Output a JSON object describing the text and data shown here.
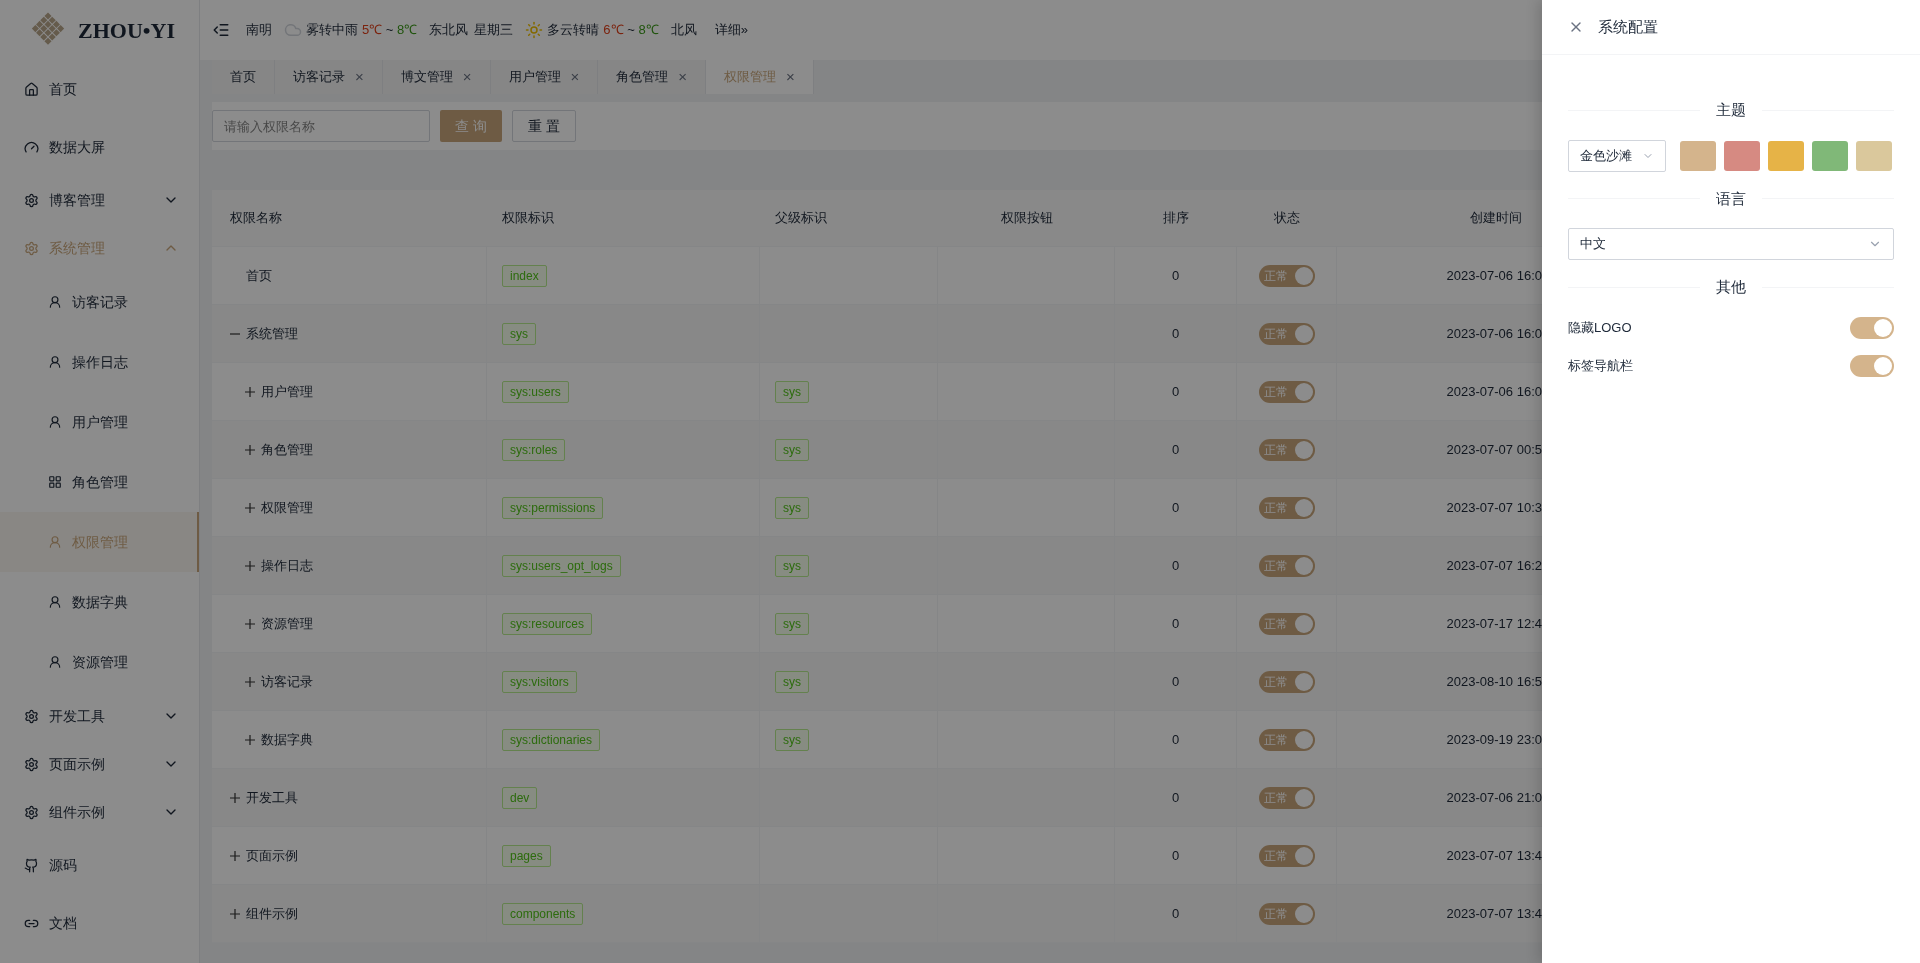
{
  "header": {
    "logo": "ZHOU•YI",
    "weather": {
      "city": "南明",
      "days": [
        {
          "desc": "雾转中雨",
          "low": "5℃",
          "sep": "~",
          "high": "8℃",
          "wind": "东北风",
          "weekday": "星期三"
        },
        {
          "desc": "多云转晴",
          "low": "6℃",
          "sep": "~",
          "high": "8℃",
          "wind": "北风"
        }
      ],
      "more": "详细»"
    }
  },
  "sidebar": {
    "items": [
      {
        "label": "首页",
        "selected": false
      },
      {
        "label": "数据大屏",
        "selected": false
      },
      {
        "label": "博客管理",
        "selected": false,
        "expanded": false
      },
      {
        "label": "系统管理",
        "selected": true,
        "expanded": true,
        "children": [
          {
            "label": "访客记录",
            "selected": false
          },
          {
            "label": "操作日志",
            "selected": false
          },
          {
            "label": "用户管理",
            "selected": false
          },
          {
            "label": "角色管理",
            "selected": false
          },
          {
            "label": "权限管理",
            "selected": true
          },
          {
            "label": "数据字典",
            "selected": false
          },
          {
            "label": "资源管理",
            "selected": false
          }
        ]
      },
      {
        "label": "开发工具",
        "selected": false,
        "expanded": false
      },
      {
        "label": "页面示例",
        "selected": false,
        "expanded": false
      },
      {
        "label": "组件示例",
        "selected": false,
        "expanded": false
      },
      {
        "label": "源码",
        "selected": false
      },
      {
        "label": "文档",
        "selected": false
      }
    ]
  },
  "tabs": [
    {
      "label": "首页",
      "selected": false
    },
    {
      "label": "访客记录",
      "selected": false,
      "close": "×"
    },
    {
      "label": "博文管理",
      "selected": false,
      "close": "×"
    },
    {
      "label": "用户管理",
      "selected": false,
      "close": "×"
    },
    {
      "label": "角色管理",
      "selected": false,
      "close": "×"
    },
    {
      "label": "权限管理",
      "selected": true,
      "close": "×"
    }
  ],
  "search": {
    "placeholder": "请输入权限名称",
    "buttons": [
      "查 询",
      "重 置"
    ]
  },
  "table": {
    "columns": [
      "权限名称",
      "权限标识",
      "父级标识",
      "权限按钮",
      "排序",
      "状态",
      "创建时间"
    ],
    "rows": [
      {
        "name": "首页",
        "key": "index",
        "sort": "0",
        "status": {
          "label": "正常",
          "on": true
        },
        "created": "2023-07-06 16:0"
      },
      {
        "name": "系统管理",
        "expanded": true,
        "key": "sys",
        "sort": "0",
        "status": {
          "label": "正常",
          "on": true
        },
        "created": "2023-07-06 16:0",
        "children": [
          {
            "name": "用户管理",
            "expanded": false,
            "key": "sys:users",
            "parent": "sys",
            "sort": "0",
            "status": {
              "label": "正常",
              "on": true
            },
            "created": "2023-07-06 16:0"
          },
          {
            "name": "角色管理",
            "expanded": false,
            "key": "sys:roles",
            "parent": "sys",
            "sort": "0",
            "status": {
              "label": "正常",
              "on": true
            },
            "created": "2023-07-07 00:5"
          },
          {
            "name": "权限管理",
            "expanded": false,
            "key": "sys:permissions",
            "parent": "sys",
            "sort": "0",
            "status": {
              "label": "正常",
              "on": true
            },
            "created": "2023-07-07 10:3"
          },
          {
            "name": "操作日志",
            "expanded": false,
            "key": "sys:users_opt_logs",
            "parent": "sys",
            "sort": "0",
            "status": {
              "label": "正常",
              "on": true
            },
            "created": "2023-07-07 16:2"
          },
          {
            "name": "资源管理",
            "expanded": false,
            "key": "sys:resources",
            "parent": "sys",
            "sort": "0",
            "status": {
              "label": "正常",
              "on": true
            },
            "created": "2023-07-17 12:4"
          },
          {
            "name": "访客记录",
            "expanded": false,
            "key": "sys:visitors",
            "parent": "sys",
            "sort": "0",
            "status": {
              "label": "正常",
              "on": true
            },
            "created": "2023-08-10 16:5"
          },
          {
            "name": "数据字典",
            "expanded": false,
            "key": "sys:dictionaries",
            "parent": "sys",
            "sort": "0",
            "status": {
              "label": "正常",
              "on": true
            },
            "created": "2023-09-19 23:0"
          }
        ]
      },
      {
        "name": "开发工具",
        "expanded": false,
        "key": "dev",
        "sort": "0",
        "status": {
          "label": "正常",
          "on": true
        },
        "created": "2023-07-06 21:0"
      },
      {
        "name": "页面示例",
        "expanded": false,
        "key": "pages",
        "sort": "0",
        "status": {
          "label": "正常",
          "on": true
        },
        "created": "2023-07-07 13:4"
      },
      {
        "name": "组件示例",
        "expanded": false,
        "key": "components",
        "sort": "0",
        "status": {
          "label": "正常",
          "on": true
        },
        "created": "2023-07-07 13:4"
      }
    ]
  },
  "drawer": {
    "title": "系统配置",
    "sections": [
      {
        "heading": "主题",
        "theme_select": "金色沙滩",
        "swatches": [
          {
            "color": "#d4b48c"
          },
          {
            "color": "#d68a82"
          },
          {
            "color": "#e6b347"
          },
          {
            "color": "#80b878"
          },
          {
            "color": "#dac89c"
          }
        ]
      },
      {
        "heading": "语言",
        "language_select": "中文"
      },
      {
        "heading": "其他",
        "toggles": [
          {
            "label": "隐藏LOGO",
            "on": true
          },
          {
            "label": "标签导航栏",
            "on": true
          }
        ]
      }
    ]
  }
}
